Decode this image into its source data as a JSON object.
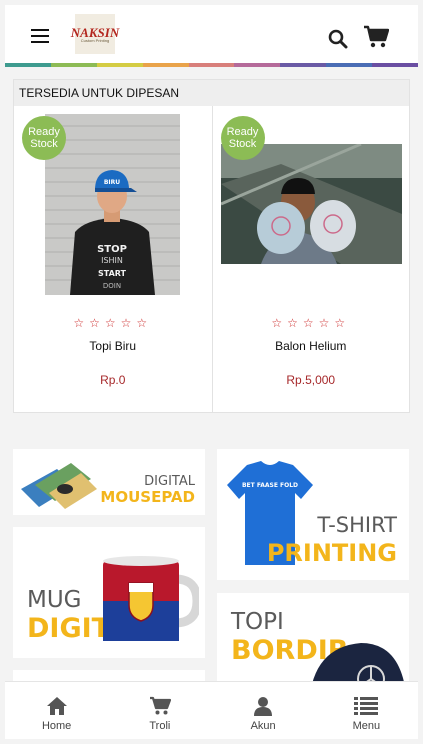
{
  "header": {
    "logo_text": "NAKSIN",
    "logo_subtext": "Custom Printing"
  },
  "section": {
    "title": "TERSEDIA UNTUK DIPESAN"
  },
  "products": [
    {
      "badge": "Ready Stock",
      "rating": "☆☆☆☆☆",
      "name": "Topi Biru",
      "price": "Rp.0"
    },
    {
      "badge": "Ready Stock",
      "rating": "☆☆☆☆☆",
      "name": "Balon Helium",
      "price": "Rp.5,000"
    }
  ],
  "banners": {
    "mousepad": {
      "line1": "DIGITAL",
      "line2": "MOUSEPAD"
    },
    "tshirt": {
      "line1": "T-SHIRT",
      "line2": "PRINTING",
      "shirt_text": "BET FAASE FOLD"
    },
    "mug": {
      "line1": "MUG",
      "line2": "DIGITAL"
    },
    "topi": {
      "line1": "TOPI",
      "line2": "BORDIR"
    }
  },
  "photo_text": {
    "cap": "BIRU",
    "shirt_lines": [
      "STOP",
      "ISHIN",
      "START",
      "DOIN"
    ]
  },
  "bottom_nav": [
    {
      "label": "Home",
      "icon": "home-icon"
    },
    {
      "label": "Troli",
      "icon": "cart-icon"
    },
    {
      "label": "Akun",
      "icon": "user-icon"
    },
    {
      "label": "Menu",
      "icon": "list-icon"
    }
  ],
  "colors": {
    "badge": "#8cbc55",
    "price": "#a6282a",
    "stars": "#cc2a2a",
    "banner_accent": "#f3b51b"
  }
}
